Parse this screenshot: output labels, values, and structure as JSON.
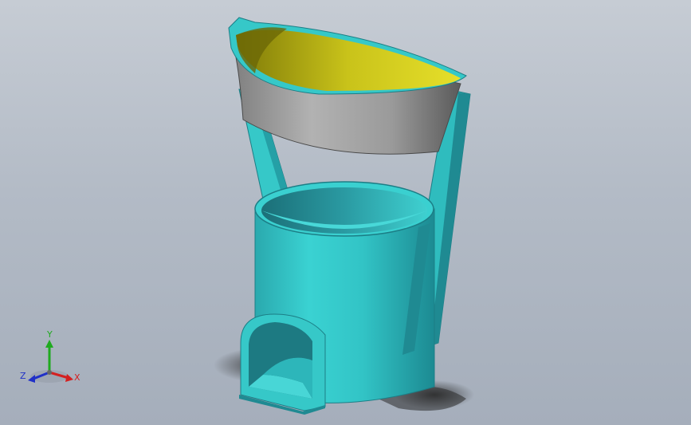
{
  "viewport": {
    "background_top": "#c6ccd4",
    "background_bottom": "#a5aebb"
  },
  "model": {
    "body_color": "#36c8c8",
    "body_shade_color": "#1f8a92",
    "funnel_outer_color": "#9a9a9a",
    "funnel_inner_color": "#d2cc1a",
    "shadow_color": "#3a3a3a"
  },
  "triad": {
    "x_label": "X",
    "y_label": "Y",
    "z_label": "Z",
    "x_color": "#d42020",
    "y_color": "#1faa1f",
    "z_color": "#2030c8"
  }
}
